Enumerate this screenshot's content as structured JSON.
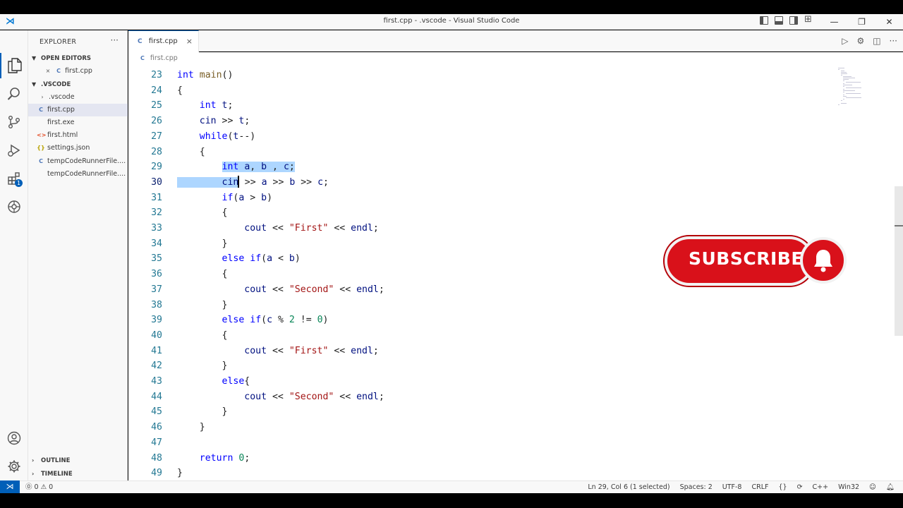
{
  "window": {
    "title": "first.cpp - .vscode - Visual Studio Code"
  },
  "icons": {
    "app": "vscode-logo-icon",
    "layout": [
      "toggle-primary-sidebar-icon",
      "toggle-panel-icon",
      "toggle-secondary-sidebar-icon",
      "customize-layout-icon"
    ],
    "activity": [
      "explorer-icon",
      "search-icon",
      "source-control-icon",
      "run-debug-icon",
      "extensions-icon",
      "remote-explorer-icon",
      "accounts-icon",
      "manage-gear-icon"
    ]
  },
  "activity_badge": "1",
  "sidebar": {
    "title": "EXPLORER",
    "more": "···",
    "open_editors": {
      "label": "OPEN EDITORS",
      "items": [
        {
          "icon": "close-icon",
          "name": "first.cpp"
        }
      ]
    },
    "folder": {
      "label": ".VSCODE",
      "items": [
        {
          "type": "folder",
          "icon": "chevron-right-icon",
          "name": ".vscode"
        },
        {
          "type": "cpp",
          "icon": "cpp-file-icon",
          "name": "first.cpp",
          "selected": true
        },
        {
          "type": "exe",
          "icon": "",
          "name": "first.exe"
        },
        {
          "type": "html",
          "icon": "html-file-icon",
          "name": "first.html"
        },
        {
          "type": "json",
          "icon": "json-file-icon",
          "name": "settings.json"
        },
        {
          "type": "cpp",
          "icon": "cpp-file-icon",
          "name": "tempCodeRunnerFile...."
        },
        {
          "type": "exe",
          "icon": "",
          "name": "tempCodeRunnerFile...."
        }
      ]
    },
    "outline_label": "OUTLINE",
    "timeline_label": "TIMELINE"
  },
  "tab": {
    "label": "first.cpp",
    "close": "×"
  },
  "breadcrumb": {
    "file": "first.cpp"
  },
  "code": {
    "current_line": 30,
    "lines": [
      {
        "n": "23",
        "text": "int main()"
      },
      {
        "n": "24",
        "text": "{"
      },
      {
        "n": "25",
        "text": "    int t;"
      },
      {
        "n": "26",
        "text": "    cin >> t;"
      },
      {
        "n": "27",
        "text": "    while(t--)"
      },
      {
        "n": "28",
        "text": "    {"
      },
      {
        "n": "29",
        "text": "        int a, b , c;"
      },
      {
        "n": "30",
        "text": "        cin >> a >> b >> c;"
      },
      {
        "n": "31",
        "text": "        if(a > b)"
      },
      {
        "n": "32",
        "text": "        {"
      },
      {
        "n": "33",
        "text": "            cout << \"First\" << endl;"
      },
      {
        "n": "34",
        "text": "        }"
      },
      {
        "n": "35",
        "text": "        else if(a < b)"
      },
      {
        "n": "36",
        "text": "        {"
      },
      {
        "n": "37",
        "text": "            cout << \"Second\" << endl;"
      },
      {
        "n": "38",
        "text": "        }"
      },
      {
        "n": "39",
        "text": "        else if(c % 2 != 0)"
      },
      {
        "n": "40",
        "text": "        {"
      },
      {
        "n": "41",
        "text": "            cout << \"First\" << endl;"
      },
      {
        "n": "42",
        "text": "        }"
      },
      {
        "n": "43",
        "text": "        else{"
      },
      {
        "n": "44",
        "text": "            cout << \"Second\" << endl;"
      },
      {
        "n": "45",
        "text": "        }"
      },
      {
        "n": "46",
        "text": "    }"
      },
      {
        "n": "47",
        "text": ""
      },
      {
        "n": "48",
        "text": "    return 0;"
      },
      {
        "n": "49",
        "text": "}"
      }
    ]
  },
  "overlay": {
    "subscribe_label": "SUBSCRIBE",
    "icon": "bell-icon",
    "color": "#d9111a"
  },
  "statusbar": {
    "remote_icon": "remote-indicator-icon",
    "problems": "⓪ 0 ⚠ 0",
    "position": "Ln 29, Col 6 (1 selected)",
    "spaces": "Spaces: 2",
    "encoding": "UTF-8",
    "eol": "CRLF",
    "language": "C++",
    "platform": "Win32"
  },
  "colors": {
    "accent": "#005fb8",
    "selection": "#add6ff",
    "keyword": "#0000ff",
    "string": "#a31515",
    "number": "#098658"
  }
}
